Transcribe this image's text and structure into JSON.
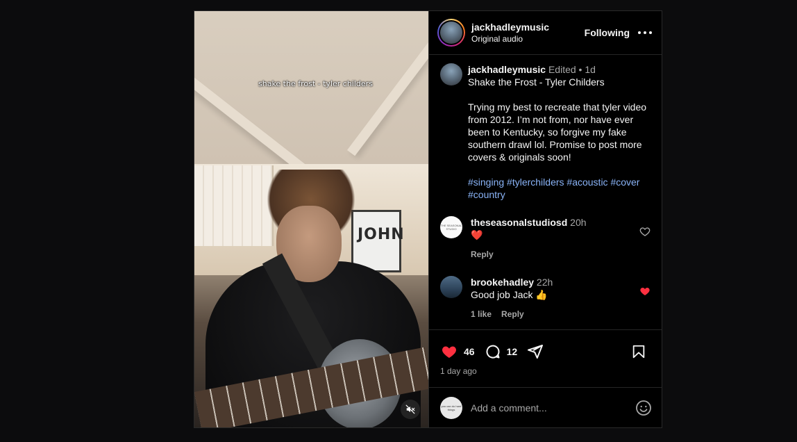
{
  "media": {
    "overlay_caption": "shake the frost - tyler childers",
    "poster_text": "JOHN",
    "mute_icon": "speaker-muted-icon"
  },
  "header": {
    "username": "jackhadleymusic",
    "audio": "Original audio",
    "follow_label": "Following",
    "more_icon": "ellipsis-icon"
  },
  "caption": {
    "username": "jackhadleymusic",
    "edited": "Edited",
    "separator": "•",
    "time": "1d",
    "title": "Shake the Frost - Tyler Childers",
    "body": "Trying my best to recreate that tyler video from 2012. I’m not from, nor have ever been to Kentucky, so forgive my fake southern drawl lol. Promise to post more covers & originals soon!",
    "hashtags": "#singing #tylerchilders #acoustic #cover #country"
  },
  "comments": [
    {
      "username": "theseasonalstudiosd",
      "time": "20h",
      "text": "❤️",
      "likes": "",
      "reply_label": "Reply",
      "liked": false,
      "avatar_text": "THE SEASONAL STUDIO"
    },
    {
      "username": "brookehadley",
      "time": "22h",
      "text": "Good job Jack 👍",
      "likes": "1 like",
      "reply_label": "Reply",
      "liked": true
    }
  ],
  "footer": {
    "like_count": "46",
    "comment_count": "12",
    "time_ago": "1 day ago",
    "comment_placeholder": "Add a comment...",
    "me_avatar_text": "you can do hard things"
  },
  "colors": {
    "like_red": "#ff3040",
    "hashtag_blue": "#8ab4f8",
    "background": "#000000"
  }
}
